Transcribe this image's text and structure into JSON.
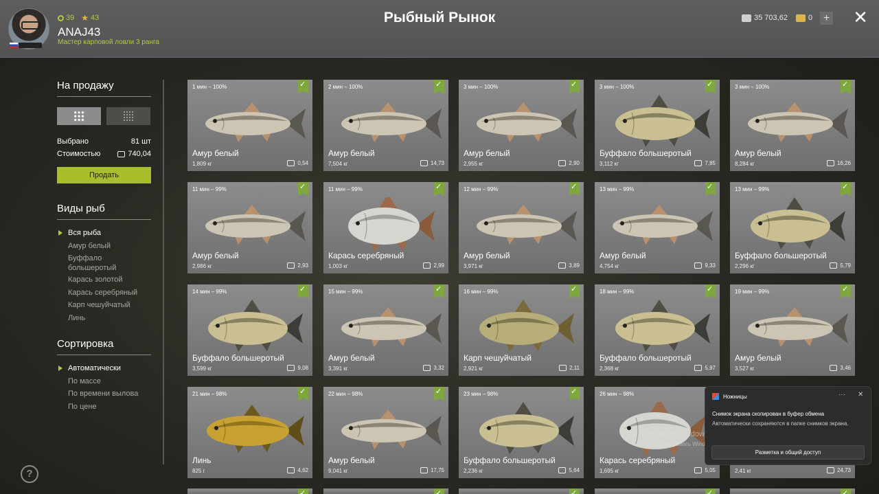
{
  "header": {
    "stat_xp": "39",
    "stat_stars": "43",
    "username": "ANAJ43",
    "subtitle": "Мастер карповой ловли 3 ранга",
    "title": "Рыбный Рынок",
    "silver": "35 703,62",
    "gold": "0",
    "plus": "+",
    "close": "✕"
  },
  "sidebar": {
    "sale_heading": "На продажу",
    "selected_label": "Выбрано",
    "selected_value": "81 шт",
    "cost_label": "Стоимостью",
    "cost_value": "740,04",
    "sell_button": "Продать",
    "types_heading": "Виды рыб",
    "types": [
      "Вся рыба",
      "Амур белый",
      "Буффало большеротый",
      "Карась золотой",
      "Карась серебряный",
      "Карп чешуйчатый",
      "Линь"
    ],
    "sort_heading": "Сортировка",
    "sort": [
      "Автоматически",
      "По массе",
      "По времени вылова",
      "По цене"
    ],
    "help": "?"
  },
  "cards": [
    {
      "time": "1 мин – 100%",
      "name": "Амур белый",
      "weight": "1,809 кг",
      "price": "0,54",
      "kind": "amur"
    },
    {
      "time": "2 мин – 100%",
      "name": "Амур белый",
      "weight": "7,504 кг",
      "price": "14,73",
      "kind": "amur"
    },
    {
      "time": "3 мин – 100%",
      "name": "Амур белый",
      "weight": "2,955 кг",
      "price": "2,90",
      "kind": "amur"
    },
    {
      "time": "3 мин – 100%",
      "name": "Буффало большеротый",
      "weight": "3,112 кг",
      "price": "7,85",
      "kind": "buffalo"
    },
    {
      "time": "3 мин – 100%",
      "name": "Амур белый",
      "weight": "8,284 кг",
      "price": "16,26",
      "kind": "amur"
    },
    {
      "time": "11 мин – 99%",
      "name": "Амур белый",
      "weight": "2,986 кг",
      "price": "2,93",
      "kind": "amur"
    },
    {
      "time": "11 мин – 99%",
      "name": "Карась серебряный",
      "weight": "1,003 кг",
      "price": "2,99",
      "kind": "crucian"
    },
    {
      "time": "12 мин – 99%",
      "name": "Амур белый",
      "weight": "3,971 кг",
      "price": "3,89",
      "kind": "amur"
    },
    {
      "time": "13 мин – 99%",
      "name": "Амур белый",
      "weight": "4,754 кг",
      "price": "9,33",
      "kind": "amur"
    },
    {
      "time": "13 мин – 99%",
      "name": "Буффало большеротый",
      "weight": "2,296 кг",
      "price": "5,79",
      "kind": "buffalo"
    },
    {
      "time": "14 мин – 99%",
      "name": "Буффало большеротый",
      "weight": "3,599 кг",
      "price": "9,08",
      "kind": "buffalo"
    },
    {
      "time": "15 мин – 99%",
      "name": "Амур белый",
      "weight": "3,391 кг",
      "price": "3,32",
      "kind": "amur"
    },
    {
      "time": "16 мин – 99%",
      "name": "Карп чешуйчатый",
      "weight": "2,921 кг",
      "price": "2,11",
      "kind": "carp"
    },
    {
      "time": "18 мин – 99%",
      "name": "Буффало большеротый",
      "weight": "2,368 кг",
      "price": "5,97",
      "kind": "buffalo"
    },
    {
      "time": "19 мин – 99%",
      "name": "Амур белый",
      "weight": "3,527 кг",
      "price": "3,46",
      "kind": "amur"
    },
    {
      "time": "21 мин – 98%",
      "name": "Линь",
      "weight": "825 г",
      "price": "4,62",
      "kind": "tench"
    },
    {
      "time": "22 мин – 98%",
      "name": "Амур белый",
      "weight": "9,041 кг",
      "price": "17,75",
      "kind": "amur"
    },
    {
      "time": "23 мин – 98%",
      "name": "Буффало большеротый",
      "weight": "2,236 кг",
      "price": "5,64",
      "kind": "buffalo"
    },
    {
      "time": "26 мин – 98%",
      "name": "Карась серебряный",
      "weight": "1,695 кг",
      "price": "5,05",
      "kind": "crucian"
    },
    {
      "time": "",
      "name": "",
      "weight": "2,41 кг",
      "price": "24,73",
      "kind": "amur"
    }
  ],
  "toast": {
    "app": "Ножницы",
    "dots": "···",
    "close": "✕",
    "title": "Снимок экрана скопирован в буфер обмена",
    "body": "Автоматически сохраняются в папке снимков экрана.",
    "button": "Разметка и общий доступ"
  },
  "watermark": {
    "line1": "Активация Windows",
    "line2": "Чтобы активировать Windows, перейдите в раздел \"Параметры\"."
  },
  "colors": {
    "accent": "#aabd2a",
    "check": "#7fa83c",
    "card": "#7d7d7d"
  }
}
